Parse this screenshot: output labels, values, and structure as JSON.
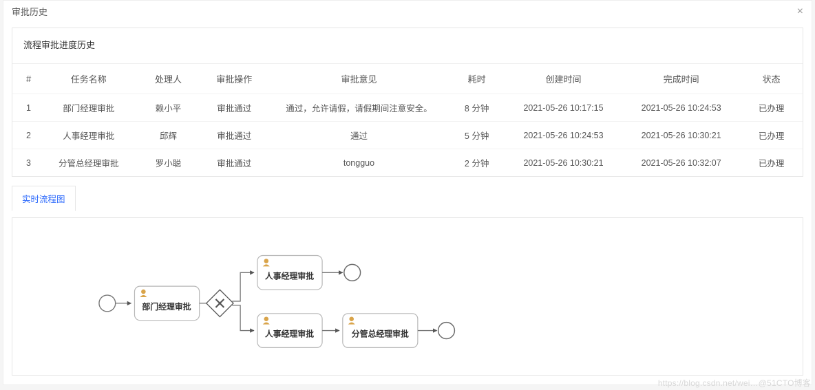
{
  "modal": {
    "title": "审批历史",
    "close_label": "×"
  },
  "panel": {
    "title": "流程审批进度历史"
  },
  "table": {
    "headers": {
      "idx": "#",
      "task": "任务名称",
      "handler": "处理人",
      "op": "审批操作",
      "comment": "审批意见",
      "duration": "耗时",
      "ctime": "创建时间",
      "ftime": "完成时间",
      "status": "状态"
    },
    "rows": [
      {
        "idx": "1",
        "task": "部门经理审批",
        "handler": "赖小平",
        "op": "审批通过",
        "comment": "通过，允许请假，请假期间注意安全。",
        "duration": "8 分钟",
        "ctime": "2021-05-26 10:17:15",
        "ftime": "2021-05-26 10:24:53",
        "status": "已办理"
      },
      {
        "idx": "2",
        "task": "人事经理审批",
        "handler": "邱辉",
        "op": "审批通过",
        "comment": "通过",
        "duration": "5 分钟",
        "ctime": "2021-05-26 10:24:53",
        "ftime": "2021-05-26 10:30:21",
        "status": "已办理"
      },
      {
        "idx": "3",
        "task": "分管总经理审批",
        "handler": "罗小聪",
        "op": "审批通过",
        "comment": "tongguo",
        "duration": "2 分钟",
        "ctime": "2021-05-26 10:30:21",
        "ftime": "2021-05-26 10:32:07",
        "status": "已办理"
      }
    ]
  },
  "tabs": {
    "diagram": "实时流程图"
  },
  "diagram": {
    "node1": "部门经理审批",
    "node2a": "人事经理审批",
    "node2b": "人事经理审批",
    "node3": "分管总经理审批"
  },
  "watermark": "https://blog.csdn.net/wei…@51CTO博客"
}
